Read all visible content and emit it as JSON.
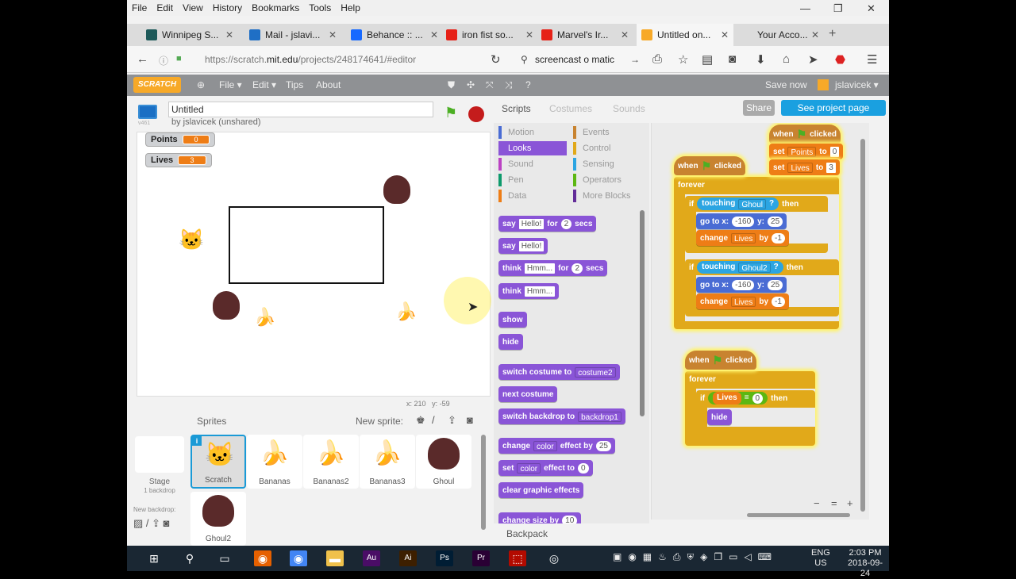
{
  "browser": {
    "menu": [
      "File",
      "Edit",
      "View",
      "History",
      "Bookmarks",
      "Tools",
      "Help"
    ],
    "tabs": [
      {
        "label": "Winnipeg S...",
        "color": "#1e5a5a",
        "icon": "winnipeg-favicon"
      },
      {
        "label": "Mail - jslavi...",
        "color": "#1f6fc5",
        "icon": "outlook-favicon"
      },
      {
        "label": "Behance :: ...",
        "color": "#1769ff",
        "icon": "behance-favicon"
      },
      {
        "label": "iron fist so...",
        "color": "#e62117",
        "icon": "youtube-favicon"
      },
      {
        "label": "Marvel's Ir...",
        "color": "#e62117",
        "icon": "youtube-favicon"
      },
      {
        "label": "Untitled on...",
        "color": "#f7a928",
        "icon": "scratch-favicon"
      },
      {
        "label": "Your Acco...",
        "color": "#dcdcdc",
        "icon": "blank-favicon"
      }
    ],
    "url_prefix": "https://scratch.",
    "url_domain": "mit.edu",
    "url_suffix": "/projects/248174641/#editor",
    "search_text": "screencast o matic"
  },
  "scratch": {
    "logo": "SCRATCH",
    "menu": {
      "file": "File ▾",
      "edit": "Edit ▾",
      "tips": "Tips",
      "about": "About"
    },
    "save_now": "Save now",
    "user": "jslavicek ▾",
    "version": "v461",
    "project_title": "Untitled",
    "byline": "by jslavicek (unshared)",
    "share": "Share",
    "see_project_page": "See project page",
    "monitors": [
      {
        "label": "Points",
        "value": "0"
      },
      {
        "label": "Lives",
        "value": "3"
      }
    ],
    "coords": {
      "x_label": "x:",
      "x": "210",
      "y_label": "y:",
      "y": "-59"
    },
    "sprites_header": "Sprites",
    "new_sprite": "New sprite:",
    "stage_label": "Stage",
    "stage_sub": "1 backdrop",
    "new_backdrop": "New backdrop:",
    "sprites": [
      {
        "name": "Scratch",
        "selected": true
      },
      {
        "name": "Bananas"
      },
      {
        "name": "Bananas2"
      },
      {
        "name": "Bananas3"
      },
      {
        "name": "Ghoul"
      },
      {
        "name": "Ghoul2"
      }
    ],
    "tabs": {
      "scripts": "Scripts",
      "costumes": "Costumes",
      "sounds": "Sounds"
    },
    "categories": [
      {
        "label": "Motion",
        "color": "#4a6cd4"
      },
      {
        "label": "Events",
        "color": "#c88330"
      },
      {
        "label": "Looks",
        "color": "#8a55d7",
        "active": true
      },
      {
        "label": "Control",
        "color": "#e1a91a"
      },
      {
        "label": "Sound",
        "color": "#bb42c3"
      },
      {
        "label": "Sensing",
        "color": "#2ca5e2"
      },
      {
        "label": "Pen",
        "color": "#0e9a6c"
      },
      {
        "label": "Operators",
        "color": "#5cb712"
      },
      {
        "label": "Data",
        "color": "#ee7d16"
      },
      {
        "label": "More Blocks",
        "color": "#632d99"
      }
    ],
    "palette_blocks": [
      [
        [
          "k",
          "say"
        ],
        [
          "s",
          "Hello!"
        ],
        [
          "k",
          "for"
        ],
        [
          "n",
          "2"
        ],
        [
          "k",
          "secs"
        ]
      ],
      [
        [
          "k",
          "say"
        ],
        [
          "s",
          "Hello!"
        ]
      ],
      [
        [
          "k",
          "think"
        ],
        [
          "s",
          "Hmm..."
        ],
        [
          "k",
          "for"
        ],
        [
          "n",
          "2"
        ],
        [
          "k",
          "secs"
        ]
      ],
      [
        [
          "k",
          "think"
        ],
        [
          "s",
          "Hmm..."
        ]
      ],
      [
        [
          "k",
          "show"
        ]
      ],
      [
        [
          "k",
          "hide"
        ]
      ],
      [
        [
          "k",
          "switch costume to"
        ],
        [
          "d",
          "costume2"
        ]
      ],
      [
        [
          "k",
          "next costume"
        ]
      ],
      [
        [
          "k",
          "switch backdrop to"
        ],
        [
          "d",
          "backdrop1"
        ]
      ],
      [
        [
          "k",
          "change"
        ],
        [
          "d",
          "color"
        ],
        [
          "k",
          "effect by"
        ],
        [
          "n",
          "25"
        ]
      ],
      [
        [
          "k",
          "set"
        ],
        [
          "d",
          "color"
        ],
        [
          "k",
          "effect to"
        ],
        [
          "n",
          "0"
        ]
      ],
      [
        [
          "k",
          "clear graphic effects"
        ]
      ],
      [
        [
          "k",
          "change size by"
        ],
        [
          "n",
          "10"
        ]
      ]
    ],
    "script_blocks": [
      [
        [
          "k",
          "when"
        ],
        [
          "f",
          ""
        ],
        [
          "k",
          "clicked"
        ]
      ],
      [
        [
          "k",
          "set"
        ],
        [
          "d",
          "Points"
        ],
        [
          "k",
          "to"
        ],
        [
          "s",
          "0"
        ]
      ],
      [
        [
          "k",
          "set"
        ],
        [
          "d",
          "Lives"
        ],
        [
          "k",
          "to"
        ],
        [
          "s",
          "3"
        ]
      ],
      [
        [
          "k",
          "when"
        ],
        [
          "f",
          ""
        ],
        [
          "k",
          "clicked"
        ]
      ],
      [
        [
          "k",
          "forever"
        ]
      ],
      [
        [
          "k",
          "if"
        ],
        [
          "b",
          "touching|Ghoul|?"
        ],
        [
          "k",
          "then"
        ]
      ],
      [
        [
          "k",
          "go to x:"
        ],
        [
          "n",
          "-160"
        ],
        [
          "k",
          "y:"
        ],
        [
          "n",
          "25"
        ]
      ],
      [
        [
          "k",
          "change"
        ],
        [
          "d",
          "Lives"
        ],
        [
          "k",
          "by"
        ],
        [
          "n",
          "-1"
        ]
      ],
      [
        [
          "k",
          "if"
        ],
        [
          "b",
          "touching|Ghoul2|?"
        ],
        [
          "k",
          "then"
        ]
      ],
      [
        [
          "k",
          "go to x:"
        ],
        [
          "n",
          "-160"
        ],
        [
          "k",
          "y:"
        ],
        [
          "n",
          "25"
        ]
      ],
      [
        [
          "k",
          "change"
        ],
        [
          "d",
          "Lives"
        ],
        [
          "k",
          "by"
        ],
        [
          "n",
          "-1"
        ]
      ],
      [
        [
          "k",
          "when"
        ],
        [
          "f",
          ""
        ],
        [
          "k",
          "clicked"
        ]
      ],
      [
        [
          "k",
          "forever"
        ]
      ],
      [
        [
          "k",
          "if"
        ],
        [
          "g",
          "Lives|=|0"
        ],
        [
          "k",
          "then"
        ]
      ],
      [
        [
          "k",
          "hide"
        ]
      ]
    ],
    "backpack": "Backpack",
    "zoom": {
      "out": "−",
      "reset": "=",
      "in": "+"
    }
  },
  "taskbar": {
    "apps": [
      "Start",
      "Search",
      "Task View",
      "Firefox",
      "Chrome",
      "File Explorer",
      "Au",
      "Ai",
      "Ps",
      "Pr",
      "Acrobat",
      "Screencast"
    ],
    "lang1": "ENG",
    "lang2": "US",
    "time": "2:03 PM",
    "date": "2018-09-24"
  }
}
